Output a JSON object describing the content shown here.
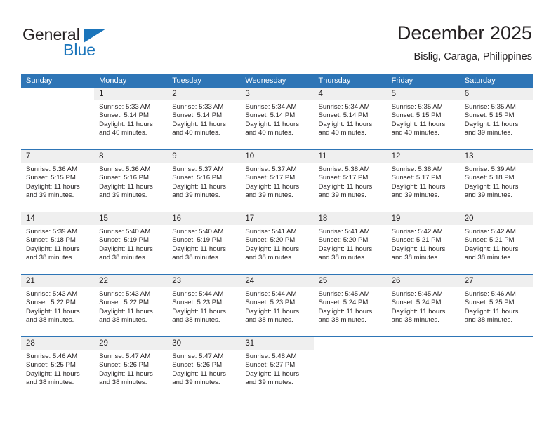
{
  "brand": {
    "name_part1": "General",
    "name_part2": "Blue",
    "logo_icon": "triangle-logo-icon"
  },
  "header": {
    "title": "December 2025",
    "subtitle": "Bislig, Caraga, Philippines"
  },
  "weekdays": [
    "Sunday",
    "Monday",
    "Tuesday",
    "Wednesday",
    "Thursday",
    "Friday",
    "Saturday"
  ],
  "colors": {
    "header_blue": "#2e75b6",
    "brand_blue": "#1b75bb",
    "daynum_band": "#efefef",
    "text": "#231f20"
  },
  "weeks": [
    [
      {
        "day": "",
        "sunrise": "",
        "sunset": "",
        "daylight_line1": "",
        "daylight_line2": ""
      },
      {
        "day": "1",
        "sunrise": "Sunrise: 5:33 AM",
        "sunset": "Sunset: 5:14 PM",
        "daylight_line1": "Daylight: 11 hours",
        "daylight_line2": "and 40 minutes."
      },
      {
        "day": "2",
        "sunrise": "Sunrise: 5:33 AM",
        "sunset": "Sunset: 5:14 PM",
        "daylight_line1": "Daylight: 11 hours",
        "daylight_line2": "and 40 minutes."
      },
      {
        "day": "3",
        "sunrise": "Sunrise: 5:34 AM",
        "sunset": "Sunset: 5:14 PM",
        "daylight_line1": "Daylight: 11 hours",
        "daylight_line2": "and 40 minutes."
      },
      {
        "day": "4",
        "sunrise": "Sunrise: 5:34 AM",
        "sunset": "Sunset: 5:14 PM",
        "daylight_line1": "Daylight: 11 hours",
        "daylight_line2": "and 40 minutes."
      },
      {
        "day": "5",
        "sunrise": "Sunrise: 5:35 AM",
        "sunset": "Sunset: 5:15 PM",
        "daylight_line1": "Daylight: 11 hours",
        "daylight_line2": "and 40 minutes."
      },
      {
        "day": "6",
        "sunrise": "Sunrise: 5:35 AM",
        "sunset": "Sunset: 5:15 PM",
        "daylight_line1": "Daylight: 11 hours",
        "daylight_line2": "and 39 minutes."
      }
    ],
    [
      {
        "day": "7",
        "sunrise": "Sunrise: 5:36 AM",
        "sunset": "Sunset: 5:15 PM",
        "daylight_line1": "Daylight: 11 hours",
        "daylight_line2": "and 39 minutes."
      },
      {
        "day": "8",
        "sunrise": "Sunrise: 5:36 AM",
        "sunset": "Sunset: 5:16 PM",
        "daylight_line1": "Daylight: 11 hours",
        "daylight_line2": "and 39 minutes."
      },
      {
        "day": "9",
        "sunrise": "Sunrise: 5:37 AM",
        "sunset": "Sunset: 5:16 PM",
        "daylight_line1": "Daylight: 11 hours",
        "daylight_line2": "and 39 minutes."
      },
      {
        "day": "10",
        "sunrise": "Sunrise: 5:37 AM",
        "sunset": "Sunset: 5:17 PM",
        "daylight_line1": "Daylight: 11 hours",
        "daylight_line2": "and 39 minutes."
      },
      {
        "day": "11",
        "sunrise": "Sunrise: 5:38 AM",
        "sunset": "Sunset: 5:17 PM",
        "daylight_line1": "Daylight: 11 hours",
        "daylight_line2": "and 39 minutes."
      },
      {
        "day": "12",
        "sunrise": "Sunrise: 5:38 AM",
        "sunset": "Sunset: 5:17 PM",
        "daylight_line1": "Daylight: 11 hours",
        "daylight_line2": "and 39 minutes."
      },
      {
        "day": "13",
        "sunrise": "Sunrise: 5:39 AM",
        "sunset": "Sunset: 5:18 PM",
        "daylight_line1": "Daylight: 11 hours",
        "daylight_line2": "and 39 minutes."
      }
    ],
    [
      {
        "day": "14",
        "sunrise": "Sunrise: 5:39 AM",
        "sunset": "Sunset: 5:18 PM",
        "daylight_line1": "Daylight: 11 hours",
        "daylight_line2": "and 38 minutes."
      },
      {
        "day": "15",
        "sunrise": "Sunrise: 5:40 AM",
        "sunset": "Sunset: 5:19 PM",
        "daylight_line1": "Daylight: 11 hours",
        "daylight_line2": "and 38 minutes."
      },
      {
        "day": "16",
        "sunrise": "Sunrise: 5:40 AM",
        "sunset": "Sunset: 5:19 PM",
        "daylight_line1": "Daylight: 11 hours",
        "daylight_line2": "and 38 minutes."
      },
      {
        "day": "17",
        "sunrise": "Sunrise: 5:41 AM",
        "sunset": "Sunset: 5:20 PM",
        "daylight_line1": "Daylight: 11 hours",
        "daylight_line2": "and 38 minutes."
      },
      {
        "day": "18",
        "sunrise": "Sunrise: 5:41 AM",
        "sunset": "Sunset: 5:20 PM",
        "daylight_line1": "Daylight: 11 hours",
        "daylight_line2": "and 38 minutes."
      },
      {
        "day": "19",
        "sunrise": "Sunrise: 5:42 AM",
        "sunset": "Sunset: 5:21 PM",
        "daylight_line1": "Daylight: 11 hours",
        "daylight_line2": "and 38 minutes."
      },
      {
        "day": "20",
        "sunrise": "Sunrise: 5:42 AM",
        "sunset": "Sunset: 5:21 PM",
        "daylight_line1": "Daylight: 11 hours",
        "daylight_line2": "and 38 minutes."
      }
    ],
    [
      {
        "day": "21",
        "sunrise": "Sunrise: 5:43 AM",
        "sunset": "Sunset: 5:22 PM",
        "daylight_line1": "Daylight: 11 hours",
        "daylight_line2": "and 38 minutes."
      },
      {
        "day": "22",
        "sunrise": "Sunrise: 5:43 AM",
        "sunset": "Sunset: 5:22 PM",
        "daylight_line1": "Daylight: 11 hours",
        "daylight_line2": "and 38 minutes."
      },
      {
        "day": "23",
        "sunrise": "Sunrise: 5:44 AM",
        "sunset": "Sunset: 5:23 PM",
        "daylight_line1": "Daylight: 11 hours",
        "daylight_line2": "and 38 minutes."
      },
      {
        "day": "24",
        "sunrise": "Sunrise: 5:44 AM",
        "sunset": "Sunset: 5:23 PM",
        "daylight_line1": "Daylight: 11 hours",
        "daylight_line2": "and 38 minutes."
      },
      {
        "day": "25",
        "sunrise": "Sunrise: 5:45 AM",
        "sunset": "Sunset: 5:24 PM",
        "daylight_line1": "Daylight: 11 hours",
        "daylight_line2": "and 38 minutes."
      },
      {
        "day": "26",
        "sunrise": "Sunrise: 5:45 AM",
        "sunset": "Sunset: 5:24 PM",
        "daylight_line1": "Daylight: 11 hours",
        "daylight_line2": "and 38 minutes."
      },
      {
        "day": "27",
        "sunrise": "Sunrise: 5:46 AM",
        "sunset": "Sunset: 5:25 PM",
        "daylight_line1": "Daylight: 11 hours",
        "daylight_line2": "and 38 minutes."
      }
    ],
    [
      {
        "day": "28",
        "sunrise": "Sunrise: 5:46 AM",
        "sunset": "Sunset: 5:25 PM",
        "daylight_line1": "Daylight: 11 hours",
        "daylight_line2": "and 38 minutes."
      },
      {
        "day": "29",
        "sunrise": "Sunrise: 5:47 AM",
        "sunset": "Sunset: 5:26 PM",
        "daylight_line1": "Daylight: 11 hours",
        "daylight_line2": "and 38 minutes."
      },
      {
        "day": "30",
        "sunrise": "Sunrise: 5:47 AM",
        "sunset": "Sunset: 5:26 PM",
        "daylight_line1": "Daylight: 11 hours",
        "daylight_line2": "and 39 minutes."
      },
      {
        "day": "31",
        "sunrise": "Sunrise: 5:48 AM",
        "sunset": "Sunset: 5:27 PM",
        "daylight_line1": "Daylight: 11 hours",
        "daylight_line2": "and 39 minutes."
      },
      {
        "day": "",
        "sunrise": "",
        "sunset": "",
        "daylight_line1": "",
        "daylight_line2": ""
      },
      {
        "day": "",
        "sunrise": "",
        "sunset": "",
        "daylight_line1": "",
        "daylight_line2": ""
      },
      {
        "day": "",
        "sunrise": "",
        "sunset": "",
        "daylight_line1": "",
        "daylight_line2": ""
      }
    ]
  ]
}
